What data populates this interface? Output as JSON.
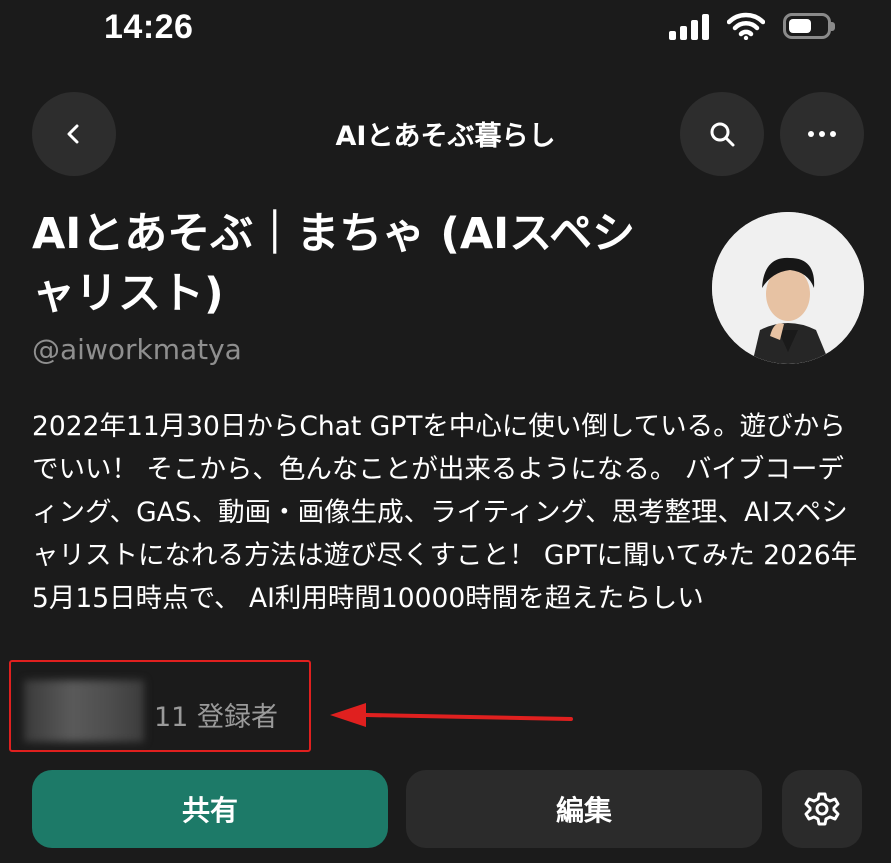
{
  "status_bar": {
    "time": "14:26"
  },
  "header": {
    "title": "AIとあそぶ暮らし",
    "back_icon": "chevron-left-icon",
    "search_icon": "search-icon",
    "more_icon": "more-horizontal-icon"
  },
  "profile": {
    "name": "AIとあそぶ｜まちゃ (AIスペシャリスト)",
    "handle": "@aiworkmatya",
    "bio": "2022年11月30日からChat GPTを中心に使い倒している。遊びからでいい！ そこから、色んなことが出来るようになる。 バイブコーディング、GAS、動画・画像生成、ライティング、思考整理、AIスペシャリストになれる方法は遊び尽くすこと！ GPTに聞いてみた 2026年5月15日時点で、 AI利用時間10000時間を超えたらしい",
    "subscribers": "11 登録者"
  },
  "actions": {
    "share_label": "共有",
    "edit_label": "編集",
    "settings_icon": "gear-icon"
  },
  "colors": {
    "background": "#1b1b1b",
    "share_button": "#1d7a68",
    "annotation": "#e0201f"
  }
}
